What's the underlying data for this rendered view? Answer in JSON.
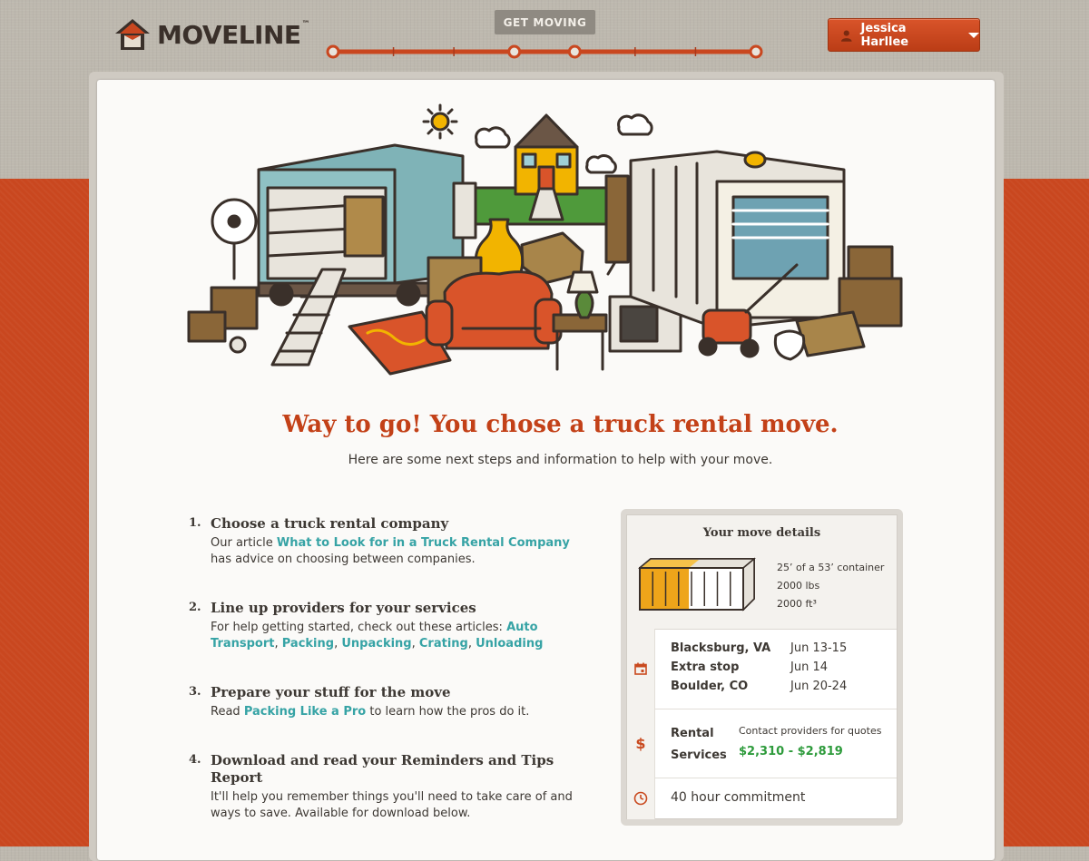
{
  "brand": {
    "name": "MOVELINE",
    "tm": "™"
  },
  "progress": {
    "label": "GET MOVING",
    "step_count": 7
  },
  "user": {
    "name": "Jessica Harllee"
  },
  "hero": {
    "headline": "Way to go! You chose a truck rental move.",
    "subhead": "Here are some next steps and information to help with your move."
  },
  "steps": [
    {
      "number": "1.",
      "title": "Choose a truck rental company",
      "pre": "Our article ",
      "link": "What to Look for in a Truck Rental Company",
      "post": " has advice on choosing between companies."
    },
    {
      "number": "2.",
      "title": "Line up providers for your services",
      "pre": "For help getting started, check out these articles: ",
      "links": [
        "Auto Transport",
        "Packing",
        "Unpacking",
        "Crating",
        "Unloading"
      ],
      "sep": ", "
    },
    {
      "number": "3.",
      "title": "Prepare your stuff for the move",
      "pre": "Read ",
      "link": "Packing Like a Pro",
      "post": " to learn how the pros do it."
    },
    {
      "number": "4.",
      "title": "Download and read your Reminders and Tips Report",
      "body": "It'll help you remember things you'll need to take care of and ways to save. Available for download below."
    }
  ],
  "move_details": {
    "title": "Your move details",
    "container_fill_fraction": 0.47,
    "capacity": [
      "25’ of a 53’ container",
      "2000 lbs",
      "2000 ft³"
    ],
    "stops": [
      {
        "place": "Blacksburg, VA",
        "dates": "Jun 13-15"
      },
      {
        "place": "Extra stop",
        "dates": "Jun 14"
      },
      {
        "place": "Boulder, CO",
        "dates": "Jun 20-24"
      }
    ],
    "services": {
      "label_line1": "Rental",
      "label_line2": "Services",
      "note": "Contact providers for quotes",
      "price": "$2,310 - $2,819",
      "icon": "dollar-icon",
      "symbol": "$"
    },
    "commitment": "40 hour commitment"
  },
  "colors": {
    "accent": "#c9471f",
    "link": "#36a3a5",
    "price": "#2e9b3c"
  }
}
